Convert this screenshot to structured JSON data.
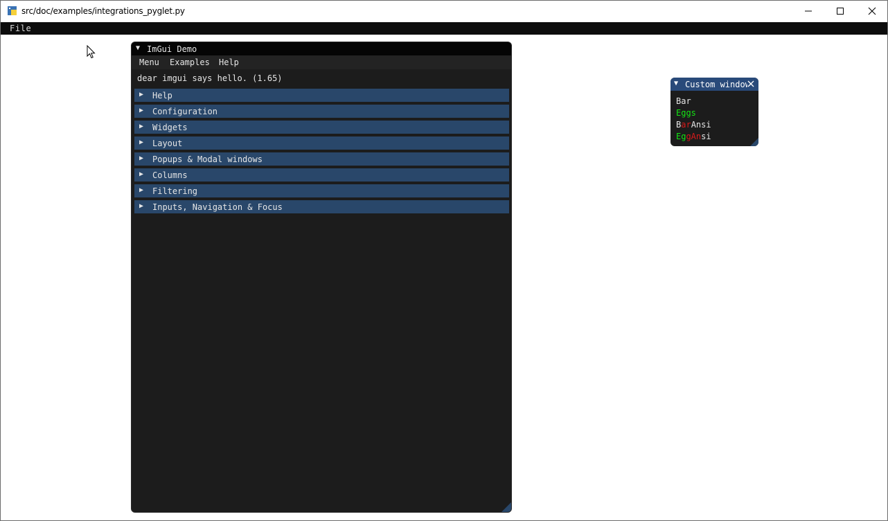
{
  "os_window": {
    "title": "src/doc/examples/integrations_pyglet.py",
    "menu": {
      "file_label": "File"
    }
  },
  "demo_window": {
    "title": "ImGui Demo",
    "menu": {
      "menu_label": "Menu",
      "examples_label": "Examples",
      "help_label": "Help"
    },
    "hello_text": "dear imgui says hello. (1.65)",
    "headers": [
      {
        "label": "Help"
      },
      {
        "label": "Configuration"
      },
      {
        "label": "Widgets"
      },
      {
        "label": "Layout"
      },
      {
        "label": "Popups & Modal windows"
      },
      {
        "label": "Columns"
      },
      {
        "label": "Filtering"
      },
      {
        "label": "Inputs, Navigation & Focus"
      }
    ]
  },
  "custom_window": {
    "title": "Custom window",
    "lines": {
      "bar": "Bar",
      "eggs": "Eggs",
      "barAnsi": {
        "p1": "B",
        "p2": "ar",
        "p3": "Ansi"
      },
      "eggAnsi": {
        "p1": "Eg",
        "p2": "gAn",
        "p3": "si"
      }
    }
  },
  "colors": {
    "header_bg": "#29476a",
    "window_bg": "#1c1c1c",
    "custom_title_bg": "#294a7a",
    "green_text": "#14e414",
    "red_text": "#d81a1a"
  },
  "icons": [
    "python-app-icon",
    "minimize-icon",
    "maximize-icon",
    "close-icon",
    "mouse-cursor-icon",
    "collapse-triangle-icon",
    "expand-arrow-icon",
    "close-x-icon",
    "resize-grip-icon"
  ]
}
